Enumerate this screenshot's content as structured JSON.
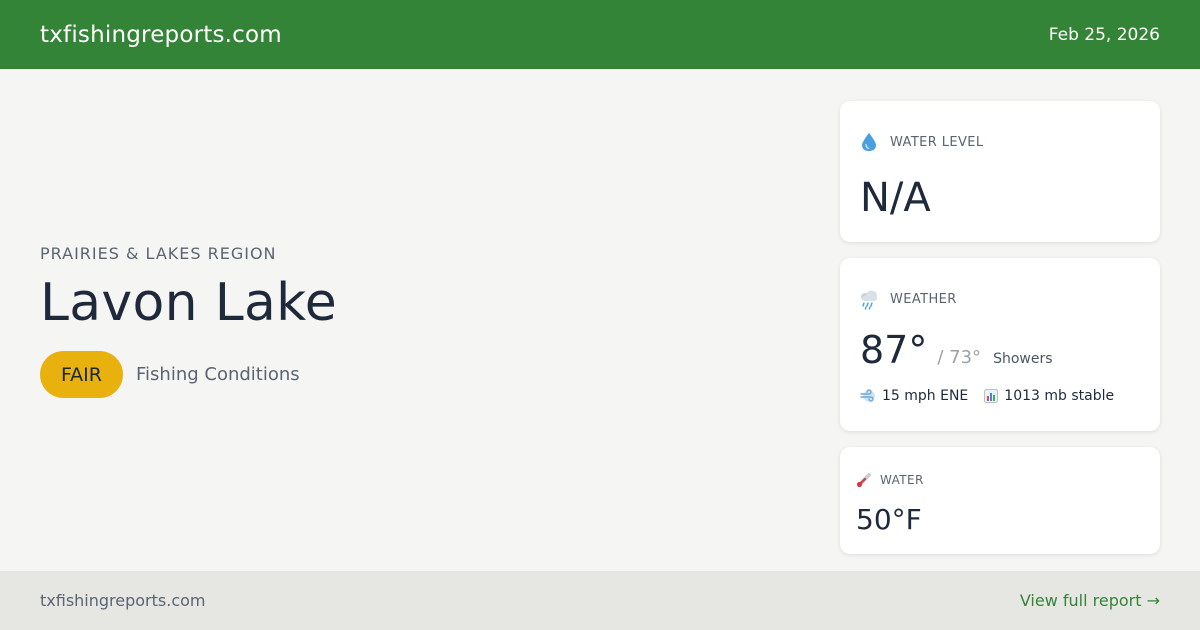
{
  "header": {
    "site_title": "txfishingreports.com",
    "date": "Feb 25, 2026",
    "background_color": "#348438"
  },
  "lake": {
    "region": "PRAIRIES & LAKES REGION",
    "name": "Lavon Lake",
    "status": "FAIR",
    "status_color": "#e8b10e",
    "status_label": "Fishing Conditions"
  },
  "water_level": {
    "icon": "water-drop-icon",
    "label": "WATER LEVEL",
    "value": "N/A"
  },
  "weather": {
    "icon": "rain-cloud-icon",
    "label": "WEATHER",
    "high": "87°",
    "low": "/ 73°",
    "condition": "Showers",
    "wind_icon": "wind-icon",
    "wind": "15 mph ENE",
    "pressure_icon": "bar-chart-icon",
    "pressure": "1013 mb stable"
  },
  "water_temp": {
    "icon": "thermometer-icon",
    "label": "WATER",
    "value": "50°F"
  },
  "footer": {
    "site": "txfishingreports.com",
    "link": "View full report →"
  }
}
